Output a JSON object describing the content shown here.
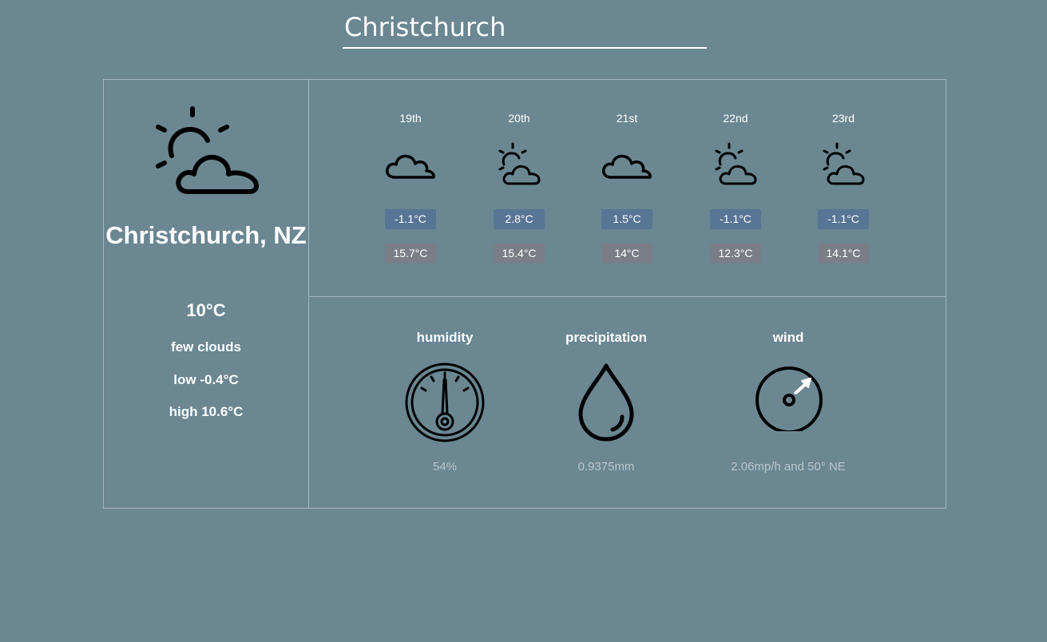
{
  "search": {
    "value": "Christchurch"
  },
  "current": {
    "icon": "partly-cloudy-icon",
    "city": "Christchurch, NZ",
    "temp": "10°C",
    "description": "few clouds",
    "low": "low -0.4°C",
    "high": "high 10.6°C"
  },
  "forecast": [
    {
      "date": "19th",
      "icon": "cloud-icon",
      "low": "-1.1°C",
      "high": "15.7°C"
    },
    {
      "date": "20th",
      "icon": "partly-cloudy-icon",
      "low": "2.8°C",
      "high": "15.4°C"
    },
    {
      "date": "21st",
      "icon": "cloud-icon",
      "low": "1.5°C",
      "high": "14°C"
    },
    {
      "date": "22nd",
      "icon": "partly-cloudy-icon",
      "low": "-1.1°C",
      "high": "12.3°C"
    },
    {
      "date": "23rd",
      "icon": "partly-cloudy-icon",
      "low": "-1.1°C",
      "high": "14.1°C"
    }
  ],
  "details": {
    "humidity": {
      "title": "humidity",
      "icon": "gauge-icon",
      "value": "54%"
    },
    "precipitation": {
      "title": "precipitation",
      "icon": "droplet-icon",
      "value": "0.9375mm"
    },
    "wind": {
      "title": "wind",
      "icon": "compass-icon",
      "value": "2.06mp/h and 50° NE"
    }
  },
  "colors": {
    "background": "#6a8792",
    "low_badge": "#587595",
    "high_badge": "#7b7e87",
    "border": "#a4b6bd"
  }
}
